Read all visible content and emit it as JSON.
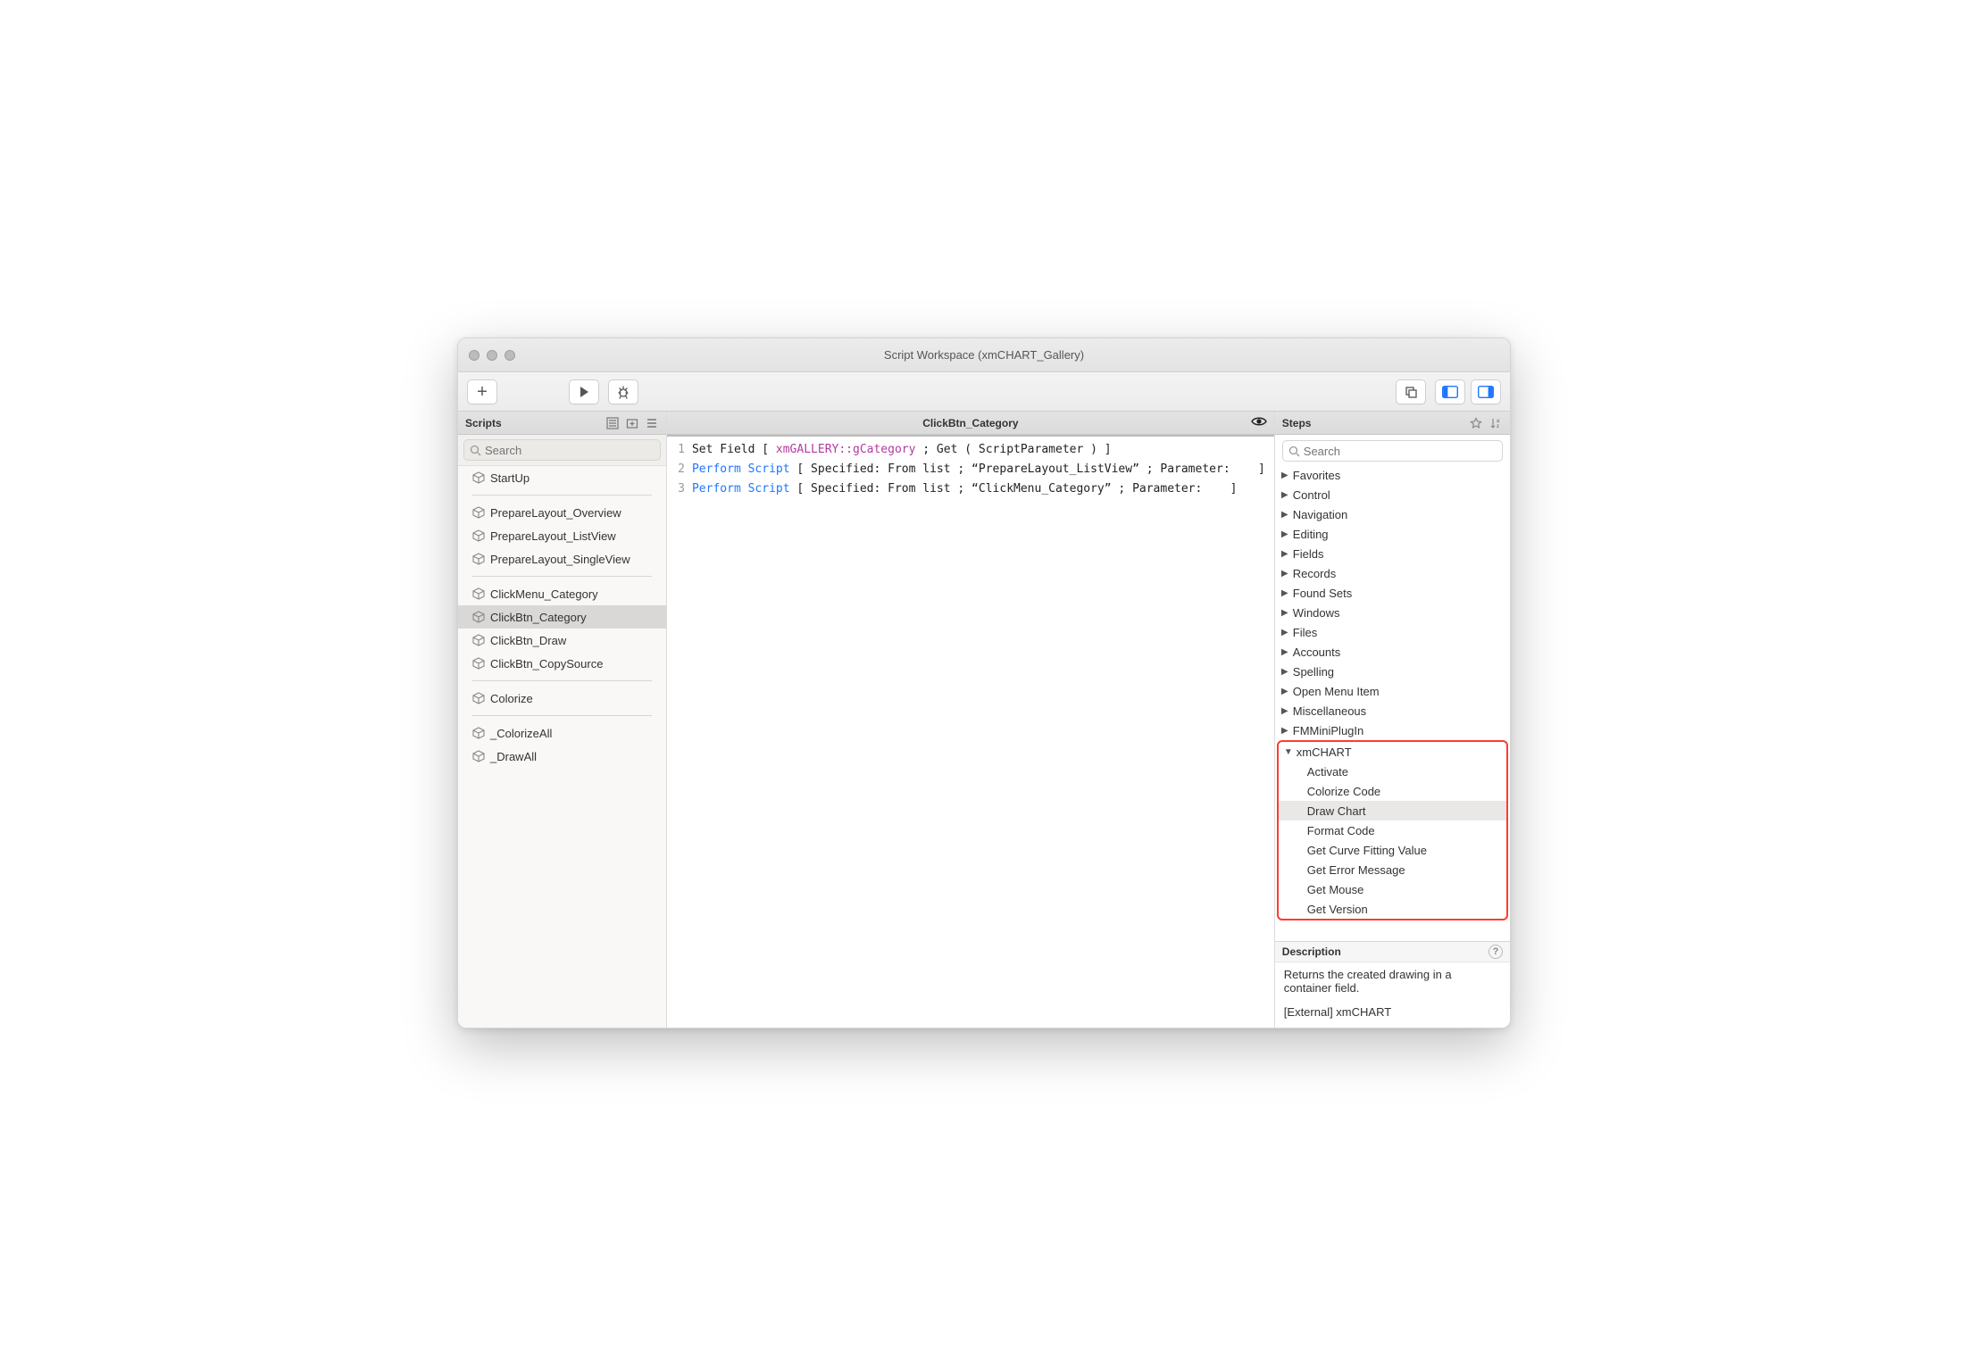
{
  "window": {
    "title": "Script Workspace (xmCHART_Gallery)"
  },
  "toolbar": {
    "new_label": "New"
  },
  "scripts": {
    "header": "Scripts",
    "search_placeholder": "Search",
    "groups": [
      {
        "items": [
          "StartUp"
        ]
      },
      {
        "items": [
          "PrepareLayout_Overview",
          "PrepareLayout_ListView",
          "PrepareLayout_SingleView"
        ]
      },
      {
        "items": [
          "ClickMenu_Category",
          "ClickBtn_Category",
          "ClickBtn_Draw",
          "ClickBtn_CopySource"
        ]
      },
      {
        "items": [
          "Colorize"
        ]
      },
      {
        "items": [
          "_ColorizeAll",
          "_DrawAll"
        ]
      }
    ],
    "selected": "ClickBtn_Category"
  },
  "editor": {
    "title": "ClickBtn_Category",
    "lines": [
      {
        "n": "1",
        "pre": "Set Field [ ",
        "field": "xmGALLERY::gCategory",
        "rest": " ; Get ( ScriptParameter ) ]"
      },
      {
        "n": "2",
        "cmd": "Perform Script",
        "rest": " [ Specified: From list ; “PrepareLayout_ListView” ; Parameter:    ]"
      },
      {
        "n": "3",
        "cmd": "Perform Script",
        "rest": " [ Specified: From list ; “ClickMenu_Category” ; Parameter:    ]"
      }
    ]
  },
  "steps": {
    "header": "Steps",
    "search_placeholder": "Search",
    "categories": [
      "Favorites",
      "Control",
      "Navigation",
      "Editing",
      "Fields",
      "Records",
      "Found Sets",
      "Windows",
      "Files",
      "Accounts",
      "Spelling",
      "Open Menu Item",
      "Miscellaneous",
      "FMMiniPlugIn"
    ],
    "expanded_category": "xmCHART",
    "expanded_items": [
      "Activate",
      "Colorize Code",
      "Draw Chart",
      "Format Code",
      "Get Curve Fitting Value",
      "Get Error Message",
      "Get Mouse",
      "Get Version"
    ],
    "selected_item": "Draw Chart"
  },
  "description": {
    "header": "Description",
    "body1": "Returns the created drawing in a container field.",
    "body2": "[External] xmCHART"
  }
}
